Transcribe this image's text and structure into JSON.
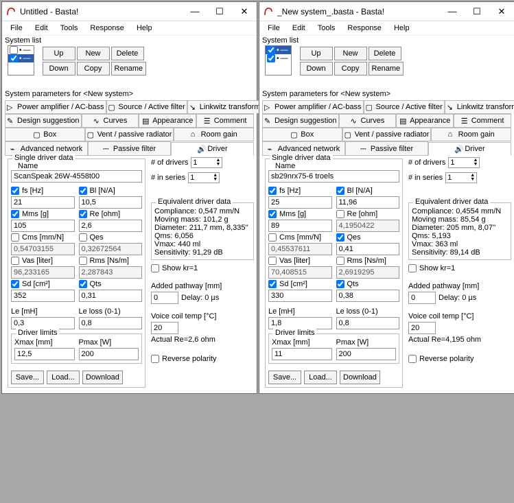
{
  "windows": [
    {
      "title": "Untitled - Basta!",
      "menu": [
        "File",
        "Edit",
        "Tools",
        "Response",
        "Help"
      ],
      "systemListLabel": "System list",
      "systems": [
        {
          "checked": false,
          "name": "<New system>",
          "selected": false
        },
        {
          "checked": true,
          "name": "<New system>",
          "selected": true
        }
      ],
      "btns": {
        "up": "Up",
        "new": "New",
        "delete": "Delete",
        "down": "Down",
        "copy": "Copy",
        "rename": "Rename"
      },
      "paramsLabel": "System parameters for <New system>",
      "tabsTop": [
        {
          "icon": "▷",
          "label": "Power amplifier / AC-bass"
        },
        {
          "icon": "▢",
          "label": "Source / Active filter"
        },
        {
          "icon": "↘",
          "label": "Linkwitz transform"
        }
      ],
      "tabsMid": [
        {
          "icon": "✎",
          "label": "Design suggestion"
        },
        {
          "icon": "∿",
          "label": "Curves"
        },
        {
          "icon": "▤",
          "label": "Appearance"
        },
        {
          "icon": "☰",
          "label": "Comment"
        }
      ],
      "tabsBot": [
        {
          "icon": "▢",
          "label": "Box"
        },
        {
          "icon": "▢",
          "label": "Vent / passive radiator"
        },
        {
          "icon": "⌂",
          "label": "Room gain"
        }
      ],
      "tabsLast": [
        {
          "icon": "⌁",
          "label": "Advanced network"
        },
        {
          "icon": "⎓",
          "label": "Passive filter"
        },
        {
          "icon": "🔊",
          "label": "Driver",
          "active": true
        }
      ],
      "driver": {
        "groupLabel": "Single driver data",
        "nameLabel": "Name",
        "name": "ScanSpeak 26W-4558t00",
        "numDriversLabel": "# of drivers",
        "numDrivers": "1",
        "numSeriesLabel": "# in series",
        "numSeries": "1",
        "fs": {
          "label": "fs [Hz]",
          "checked": true,
          "value": "21"
        },
        "mms": {
          "label": "Mms [g]",
          "checked": true,
          "value": "105"
        },
        "cms": {
          "label": "Cms [mm/N]",
          "checked": false,
          "value": "0,54703155"
        },
        "vas": {
          "label": "Vas [liter]",
          "checked": false,
          "value": "96,233165"
        },
        "sd": {
          "label": "Sd [cm²]",
          "checked": true,
          "value": "352"
        },
        "bl": {
          "label": "Bl [N/A]",
          "checked": true,
          "value": "10,5"
        },
        "re": {
          "label": "Re [ohm]",
          "checked": true,
          "value": "2,6"
        },
        "qes": {
          "label": "Qes",
          "checked": false,
          "value": "0,32672564"
        },
        "rms": {
          "label": "Rms [Ns/m]",
          "checked": false,
          "value": "2,287843"
        },
        "qts": {
          "label": "Qts",
          "checked": true,
          "value": "0,31"
        },
        "le": {
          "label": "Le [mH]",
          "value": "0,3"
        },
        "leloss": {
          "label": "Le loss (0-1)",
          "value": "0,8"
        },
        "limitsLabel": "Driver limits",
        "xmax": {
          "label": "Xmax [mm]",
          "value": "12,5"
        },
        "pmax": {
          "label": "Pmax [W]",
          "value": "200"
        },
        "save": "Save...",
        "load": "Load...",
        "download": "Download",
        "eqLabel": "Equivalent driver data",
        "eq": {
          "compliance": "Compliance: 0,547 mm/N",
          "mass": "Moving mass: 101,2 g",
          "diameter": "Diameter: 211,7 mm, 8,335''",
          "qms": "Qms: 6,056",
          "vmax": "Vmax: 440 ml",
          "sens": "Sensitivity: 91,29 dB"
        },
        "showKr": "Show kr=1",
        "pathwayLabel": "Added pathway [mm]",
        "pathway": "0",
        "delay": "Delay: 0 µs",
        "vctLabel": "Voice coil temp [°C]",
        "vct": "20",
        "actualRe": "Actual Re=2,6 ohm",
        "reverse": "Reverse polarity"
      }
    },
    {
      "title": "_New system_.basta - Basta!",
      "menu": [
        "File",
        "Edit",
        "Tools",
        "Response",
        "Help"
      ],
      "systemListLabel": "System list",
      "systems": [
        {
          "checked": true,
          "name": "<New system>",
          "selected": true
        },
        {
          "checked": true,
          "name": "<New system>",
          "selected": false
        }
      ],
      "btns": {
        "up": "Up",
        "new": "New",
        "delete": "Delete",
        "down": "Down",
        "copy": "Copy",
        "rename": "Rename"
      },
      "paramsLabel": "System parameters for <New system>",
      "tabsTop": [
        {
          "icon": "▷",
          "label": "Power amplifier / AC-bass"
        },
        {
          "icon": "▢",
          "label": "Source / Active filter"
        },
        {
          "icon": "↘",
          "label": "Linkwitz transform"
        }
      ],
      "tabsMid": [
        {
          "icon": "✎",
          "label": "Design suggestion"
        },
        {
          "icon": "∿",
          "label": "Curves"
        },
        {
          "icon": "▤",
          "label": "Appearance"
        },
        {
          "icon": "☰",
          "label": "Comment"
        }
      ],
      "tabsBot": [
        {
          "icon": "▢",
          "label": "Box"
        },
        {
          "icon": "▢",
          "label": "Vent / passive radiator"
        },
        {
          "icon": "⌂",
          "label": "Room gain"
        }
      ],
      "tabsLast": [
        {
          "icon": "⌁",
          "label": "Advanced network"
        },
        {
          "icon": "⎓",
          "label": "Passive filter"
        },
        {
          "icon": "🔊",
          "label": "Driver",
          "active": true
        }
      ],
      "driver": {
        "groupLabel": "Single driver data",
        "nameLabel": "Name",
        "name": "sb29nrx75-6 troels",
        "numDriversLabel": "# of drivers",
        "numDrivers": "1",
        "numSeriesLabel": "# in series",
        "numSeries": "1",
        "fs": {
          "label": "fs [Hz]",
          "checked": true,
          "value": "25"
        },
        "mms": {
          "label": "Mms [g]",
          "checked": true,
          "value": "89"
        },
        "cms": {
          "label": "Cms [mm/N]",
          "checked": false,
          "value": "0,45537611"
        },
        "vas": {
          "label": "Vas [liter]",
          "checked": false,
          "value": "70,408515"
        },
        "sd": {
          "label": "Sd [cm²]",
          "checked": true,
          "value": "330"
        },
        "bl": {
          "label": "Bl [N/A]",
          "checked": true,
          "value": "11,96"
        },
        "re": {
          "label": "Re [ohm]",
          "checked": false,
          "value": "4,1950422"
        },
        "qes": {
          "label": "Qes",
          "checked": true,
          "value": "0,41"
        },
        "rms": {
          "label": "Rms [Ns/m]",
          "checked": false,
          "value": "2,6919295"
        },
        "qts": {
          "label": "Qts",
          "checked": true,
          "value": "0,38"
        },
        "le": {
          "label": "Le [mH]",
          "value": "1,8"
        },
        "leloss": {
          "label": "Le loss (0-1)",
          "value": "0,8"
        },
        "limitsLabel": "Driver limits",
        "xmax": {
          "label": "Xmax [mm]",
          "value": "11"
        },
        "pmax": {
          "label": "Pmax [W]",
          "value": "200"
        },
        "save": "Save...",
        "load": "Load...",
        "download": "Download",
        "eqLabel": "Equivalent driver data",
        "eq": {
          "compliance": "Compliance: 0,4554 mm/N",
          "mass": "Moving mass: 85,54 g",
          "diameter": "Diameter: 205 mm, 8,07''",
          "qms": "Qms: 5,193",
          "vmax": "Vmax: 363 ml",
          "sens": "Sensitivity: 89,14 dB"
        },
        "showKr": "Show kr=1",
        "pathwayLabel": "Added pathway [mm]",
        "pathway": "0",
        "delay": "Delay: 0 µs",
        "vctLabel": "Voice coil temp [°C]",
        "vct": "20",
        "actualRe": "Actual Re=4,195 ohm",
        "reverse": "Reverse polarity"
      }
    }
  ]
}
